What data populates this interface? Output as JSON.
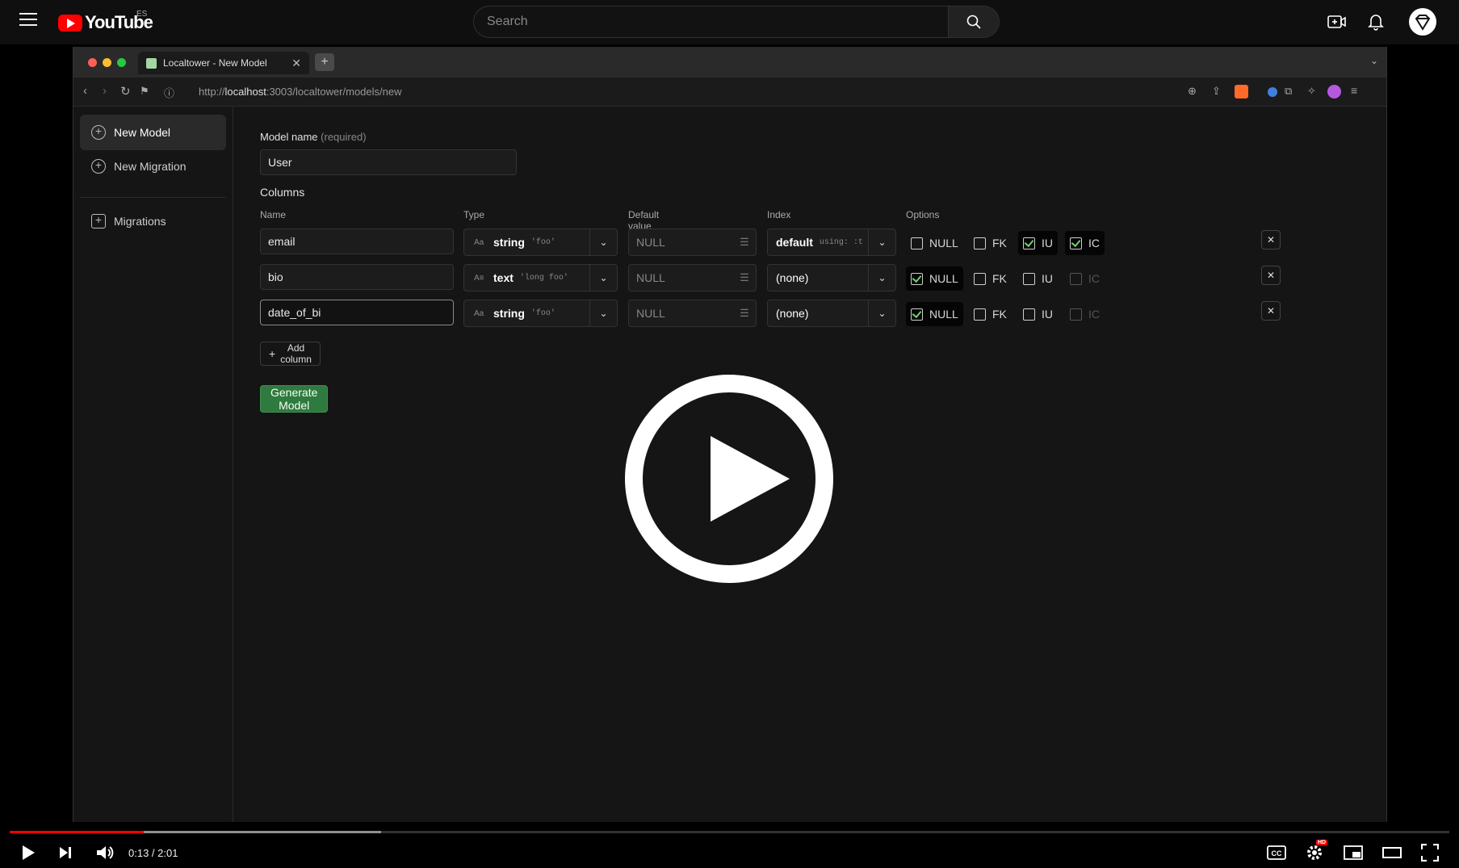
{
  "youtube": {
    "logo_text": "YouTube",
    "country": "ES",
    "search_placeholder": "Search"
  },
  "browser": {
    "tab_title": "Localtower - New Model",
    "url_prefix": "http://",
    "url_host": "localhost",
    "url_rest": ":3003/localtower/models/new"
  },
  "sidebar": {
    "items": [
      {
        "label": "New Model"
      },
      {
        "label": "New Migration"
      },
      {
        "label": "Migrations"
      }
    ]
  },
  "form": {
    "model_name_label": "Model name",
    "model_name_hint": "(required)",
    "model_name_value": "User",
    "columns_label": "Columns",
    "headers": {
      "name": "Name",
      "type": "Type",
      "default": "Default value",
      "index": "Index",
      "options": "Options"
    },
    "rows": [
      {
        "name": "email",
        "type": "string",
        "type_example": "'foo'",
        "type_icon": "Aa",
        "default": "NULL",
        "index": "default",
        "index_hint": "using: :t",
        "null": false,
        "fk": false,
        "iu": true,
        "ic": true
      },
      {
        "name": "bio",
        "type": "text",
        "type_example": "'long foo'",
        "type_icon": "A≡",
        "default": "NULL",
        "index": "(none)",
        "index_hint": "",
        "null": true,
        "fk": false,
        "iu": false,
        "ic": false
      },
      {
        "name": "date_of_bi",
        "type": "string",
        "type_example": "'foo'",
        "type_icon": "Aa",
        "default": "NULL",
        "index": "(none)",
        "index_hint": "",
        "null": true,
        "fk": false,
        "iu": false,
        "ic": false
      }
    ],
    "option_labels": {
      "null": "NULL",
      "fk": "FK",
      "iu": "IU",
      "ic": "IC"
    },
    "add_column_label": "Add column",
    "generate_label": "Generate Model"
  },
  "player": {
    "time": "0:13 / 2:01",
    "progress_played": 0.093,
    "progress_buffered": 0.258,
    "hd_badge": "HD",
    "cc_label": "CC"
  },
  "colors": {
    "youtube_red": "#ff0000",
    "generate_green": "#2f7a3f",
    "check_green": "#6fd06f"
  }
}
